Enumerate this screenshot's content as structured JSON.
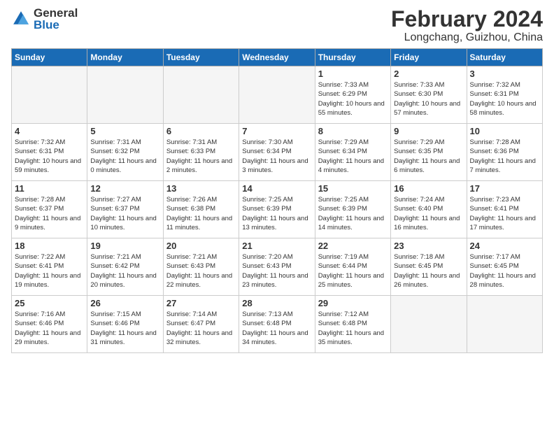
{
  "logo": {
    "general": "General",
    "blue": "Blue"
  },
  "title": "February 2024",
  "location": "Longchang, Guizhou, China",
  "headers": [
    "Sunday",
    "Monday",
    "Tuesday",
    "Wednesday",
    "Thursday",
    "Friday",
    "Saturday"
  ],
  "weeks": [
    [
      {
        "day": "",
        "info": ""
      },
      {
        "day": "",
        "info": ""
      },
      {
        "day": "",
        "info": ""
      },
      {
        "day": "",
        "info": ""
      },
      {
        "day": "1",
        "info": "Sunrise: 7:33 AM\nSunset: 6:29 PM\nDaylight: 10 hours and 55 minutes."
      },
      {
        "day": "2",
        "info": "Sunrise: 7:33 AM\nSunset: 6:30 PM\nDaylight: 10 hours and 57 minutes."
      },
      {
        "day": "3",
        "info": "Sunrise: 7:32 AM\nSunset: 6:31 PM\nDaylight: 10 hours and 58 minutes."
      }
    ],
    [
      {
        "day": "4",
        "info": "Sunrise: 7:32 AM\nSunset: 6:31 PM\nDaylight: 10 hours and 59 minutes."
      },
      {
        "day": "5",
        "info": "Sunrise: 7:31 AM\nSunset: 6:32 PM\nDaylight: 11 hours and 0 minutes."
      },
      {
        "day": "6",
        "info": "Sunrise: 7:31 AM\nSunset: 6:33 PM\nDaylight: 11 hours and 2 minutes."
      },
      {
        "day": "7",
        "info": "Sunrise: 7:30 AM\nSunset: 6:34 PM\nDaylight: 11 hours and 3 minutes."
      },
      {
        "day": "8",
        "info": "Sunrise: 7:29 AM\nSunset: 6:34 PM\nDaylight: 11 hours and 4 minutes."
      },
      {
        "day": "9",
        "info": "Sunrise: 7:29 AM\nSunset: 6:35 PM\nDaylight: 11 hours and 6 minutes."
      },
      {
        "day": "10",
        "info": "Sunrise: 7:28 AM\nSunset: 6:36 PM\nDaylight: 11 hours and 7 minutes."
      }
    ],
    [
      {
        "day": "11",
        "info": "Sunrise: 7:28 AM\nSunset: 6:37 PM\nDaylight: 11 hours and 9 minutes."
      },
      {
        "day": "12",
        "info": "Sunrise: 7:27 AM\nSunset: 6:37 PM\nDaylight: 11 hours and 10 minutes."
      },
      {
        "day": "13",
        "info": "Sunrise: 7:26 AM\nSunset: 6:38 PM\nDaylight: 11 hours and 11 minutes."
      },
      {
        "day": "14",
        "info": "Sunrise: 7:25 AM\nSunset: 6:39 PM\nDaylight: 11 hours and 13 minutes."
      },
      {
        "day": "15",
        "info": "Sunrise: 7:25 AM\nSunset: 6:39 PM\nDaylight: 11 hours and 14 minutes."
      },
      {
        "day": "16",
        "info": "Sunrise: 7:24 AM\nSunset: 6:40 PM\nDaylight: 11 hours and 16 minutes."
      },
      {
        "day": "17",
        "info": "Sunrise: 7:23 AM\nSunset: 6:41 PM\nDaylight: 11 hours and 17 minutes."
      }
    ],
    [
      {
        "day": "18",
        "info": "Sunrise: 7:22 AM\nSunset: 6:41 PM\nDaylight: 11 hours and 19 minutes."
      },
      {
        "day": "19",
        "info": "Sunrise: 7:21 AM\nSunset: 6:42 PM\nDaylight: 11 hours and 20 minutes."
      },
      {
        "day": "20",
        "info": "Sunrise: 7:21 AM\nSunset: 6:43 PM\nDaylight: 11 hours and 22 minutes."
      },
      {
        "day": "21",
        "info": "Sunrise: 7:20 AM\nSunset: 6:43 PM\nDaylight: 11 hours and 23 minutes."
      },
      {
        "day": "22",
        "info": "Sunrise: 7:19 AM\nSunset: 6:44 PM\nDaylight: 11 hours and 25 minutes."
      },
      {
        "day": "23",
        "info": "Sunrise: 7:18 AM\nSunset: 6:45 PM\nDaylight: 11 hours and 26 minutes."
      },
      {
        "day": "24",
        "info": "Sunrise: 7:17 AM\nSunset: 6:45 PM\nDaylight: 11 hours and 28 minutes."
      }
    ],
    [
      {
        "day": "25",
        "info": "Sunrise: 7:16 AM\nSunset: 6:46 PM\nDaylight: 11 hours and 29 minutes."
      },
      {
        "day": "26",
        "info": "Sunrise: 7:15 AM\nSunset: 6:46 PM\nDaylight: 11 hours and 31 minutes."
      },
      {
        "day": "27",
        "info": "Sunrise: 7:14 AM\nSunset: 6:47 PM\nDaylight: 11 hours and 32 minutes."
      },
      {
        "day": "28",
        "info": "Sunrise: 7:13 AM\nSunset: 6:48 PM\nDaylight: 11 hours and 34 minutes."
      },
      {
        "day": "29",
        "info": "Sunrise: 7:12 AM\nSunset: 6:48 PM\nDaylight: 11 hours and 35 minutes."
      },
      {
        "day": "",
        "info": ""
      },
      {
        "day": "",
        "info": ""
      }
    ]
  ]
}
